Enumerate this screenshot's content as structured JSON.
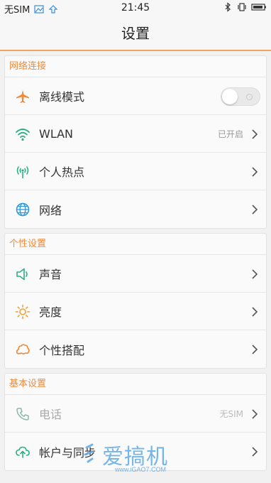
{
  "status_bar": {
    "carrier": "无SIM",
    "time": "21:45"
  },
  "header": {
    "title": "设置"
  },
  "sections": [
    {
      "title": "网络连接",
      "items": [
        {
          "label": "离线模式",
          "icon": "airplane-icon"
        },
        {
          "label": "WLAN",
          "value": "已开启",
          "icon": "wifi-icon"
        },
        {
          "label": "个人热点",
          "icon": "hotspot-icon"
        },
        {
          "label": "网络",
          "icon": "globe-icon"
        }
      ]
    },
    {
      "title": "个性设置",
      "items": [
        {
          "label": "声音",
          "icon": "speaker-icon"
        },
        {
          "label": "亮度",
          "icon": "sun-icon"
        },
        {
          "label": "个性搭配",
          "icon": "theme-icon"
        }
      ]
    },
    {
      "title": "基本设置",
      "items": [
        {
          "label": "电话",
          "value": "无SIM",
          "icon": "phone-icon"
        },
        {
          "label": "帐户与同步",
          "icon": "cloud-sync-icon"
        }
      ]
    }
  ],
  "watermark": {
    "text": "爱搞机",
    "url": "www.iGAO7.COM"
  },
  "colors": {
    "accent": "#ee8a3a",
    "wifi": "#2ab07f",
    "globe": "#2f9ae0",
    "sun": "#f0a23a"
  }
}
